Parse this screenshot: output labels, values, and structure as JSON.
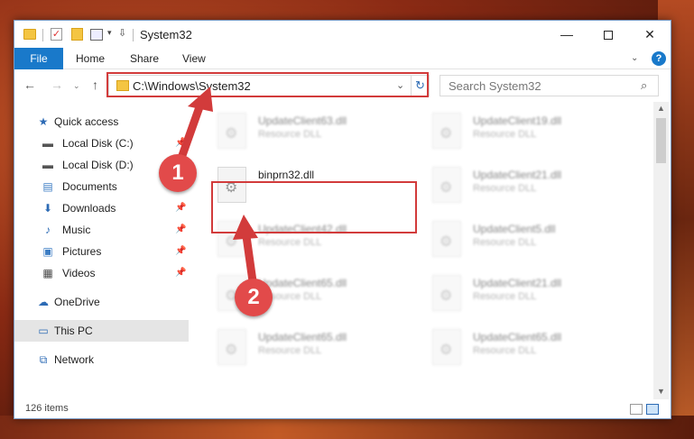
{
  "window": {
    "title": "System32",
    "qa_check_glyph": "✓",
    "qa_down_glyph": "▾",
    "qa_pin_glyph": "⇩",
    "minimize_glyph": "—",
    "close_glyph": "✕"
  },
  "ribbon": {
    "tabs": [
      "File",
      "Home",
      "Share",
      "View"
    ],
    "chevron_glyph": "⌄",
    "help_glyph": "?"
  },
  "nav": {
    "back_glyph": "←",
    "forward_glyph": "→",
    "history_glyph": "⌄",
    "up_glyph": "↑",
    "address": "C:\\Windows\\System32",
    "address_dropdown_glyph": "⌄",
    "refresh_glyph": "↻",
    "search_placeholder": "Search System32",
    "search_glyph": "⌕"
  },
  "sidebar": {
    "items": [
      {
        "label": "Quick access",
        "icon": "star-icon",
        "glyph": "★",
        "color": "#2d6bb5",
        "pinned": false
      },
      {
        "label": "Local Disk (C:)",
        "icon": "drive-icon",
        "glyph": "▬",
        "color": "#555555",
        "pinned": true
      },
      {
        "label": "Local Disk (D:)",
        "icon": "drive-icon",
        "glyph": "▬",
        "color": "#555555",
        "pinned": true
      },
      {
        "label": "Documents",
        "icon": "documents-icon",
        "glyph": "▤",
        "color": "#3c7dc4",
        "pinned": true
      },
      {
        "label": "Downloads",
        "icon": "download-icon",
        "glyph": "⬇",
        "color": "#2d6bb5",
        "pinned": true
      },
      {
        "label": "Music",
        "icon": "music-icon",
        "glyph": "♪",
        "color": "#2d6bb5",
        "pinned": true
      },
      {
        "label": "Pictures",
        "icon": "pictures-icon",
        "glyph": "▣",
        "color": "#3c7dc4",
        "pinned": true
      },
      {
        "label": "Videos",
        "icon": "video-icon",
        "glyph": "▦",
        "color": "#444444",
        "pinned": true
      },
      {
        "label": "OneDrive",
        "icon": "cloud-icon",
        "glyph": "☁",
        "color": "#2d6bb5",
        "pinned": false
      },
      {
        "label": "This PC",
        "icon": "computer-icon",
        "glyph": "▭",
        "color": "#2d6bb5",
        "pinned": false
      },
      {
        "label": "Network",
        "icon": "network-icon",
        "glyph": "⧉",
        "color": "#2d6bb5",
        "pinned": false
      }
    ],
    "pin_glyph": "📌"
  },
  "files": [
    {
      "name": "UpdateClient63.dll",
      "type": "Resource DLL"
    },
    {
      "name": "UpdateClient19.dll",
      "type": "Resource DLL"
    },
    {
      "name": "binprn32.dll",
      "type": ""
    },
    {
      "name": "UpdateClient21.dll",
      "type": "Resource DLL"
    },
    {
      "name": "UpdateClient42.dll",
      "type": "Resource DLL"
    },
    {
      "name": "UpdateClient5.dll",
      "type": "Resource DLL"
    },
    {
      "name": "UpdateClient65.dll",
      "type": "Resource DLL"
    },
    {
      "name": "UpdateClient21.dll",
      "type": "Resource DLL"
    },
    {
      "name": "UpdateClient65.dll",
      "type": "Resource DLL"
    },
    {
      "name": "UpdateClient65.dll",
      "type": "Resource DLL"
    }
  ],
  "gear_glyph": "⚙",
  "scroll": {
    "up_glyph": "▲",
    "down_glyph": "▼"
  },
  "status": {
    "item_count": "126 items"
  },
  "annotations": {
    "step1": "1",
    "step2": "2",
    "color": "#d23b3b"
  }
}
